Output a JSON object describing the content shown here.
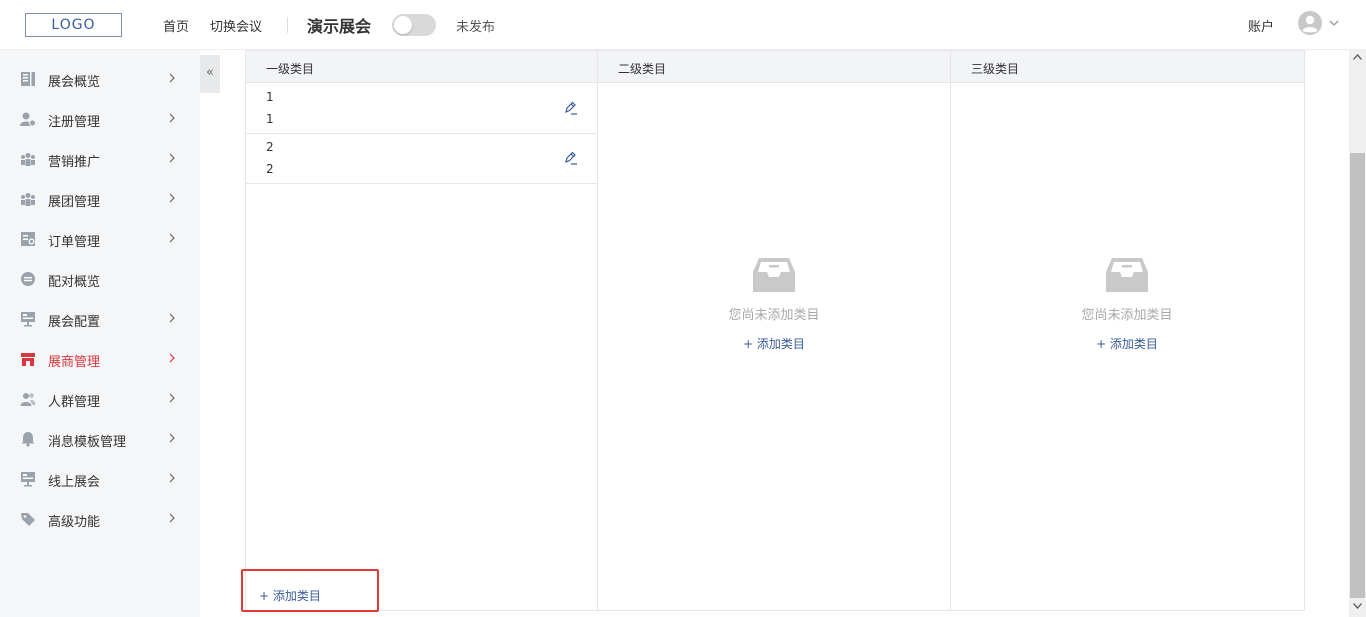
{
  "header": {
    "logo": "LOGO",
    "nav": [
      "首页",
      "切换会议"
    ],
    "expo_name": "演示展会",
    "publish_status": "未发布",
    "account": "账户"
  },
  "sidebar": {
    "items": [
      {
        "label": "展会概览",
        "icon": "document-list-icon",
        "has_arrow": true
      },
      {
        "label": "注册管理",
        "icon": "user-add-icon",
        "has_arrow": true
      },
      {
        "label": "营销推广",
        "icon": "group-icon",
        "has_arrow": true
      },
      {
        "label": "展团管理",
        "icon": "group-icon",
        "has_arrow": true
      },
      {
        "label": "订单管理",
        "icon": "order-icon",
        "has_arrow": true
      },
      {
        "label": "配对概览",
        "icon": "match-circle-icon",
        "has_arrow": false
      },
      {
        "label": "展会配置",
        "icon": "board-icon",
        "has_arrow": true
      },
      {
        "label": "展商管理",
        "icon": "store-icon",
        "has_arrow": true,
        "active": true
      },
      {
        "label": "人群管理",
        "icon": "people-icon",
        "has_arrow": true
      },
      {
        "label": "消息模板管理",
        "icon": "bell-icon",
        "has_arrow": true
      },
      {
        "label": "线上展会",
        "icon": "board-icon",
        "has_arrow": true
      },
      {
        "label": "高级功能",
        "icon": "tag-icon",
        "has_arrow": true
      }
    ],
    "collapse_label": "«",
    "active_color": "#d9363e"
  },
  "categories": {
    "columns": [
      {
        "title": "一级类目"
      },
      {
        "title": "二级类目"
      },
      {
        "title": "三级类目"
      }
    ],
    "level1": [
      {
        "line1": "1",
        "line2": "1"
      },
      {
        "line1": "2",
        "line2": "2"
      }
    ],
    "empty_text": "您尚未添加类目",
    "add_label": "+ 添加类目"
  },
  "colors": {
    "accent": "#3b5b9c",
    "highlight": "#e53935"
  }
}
